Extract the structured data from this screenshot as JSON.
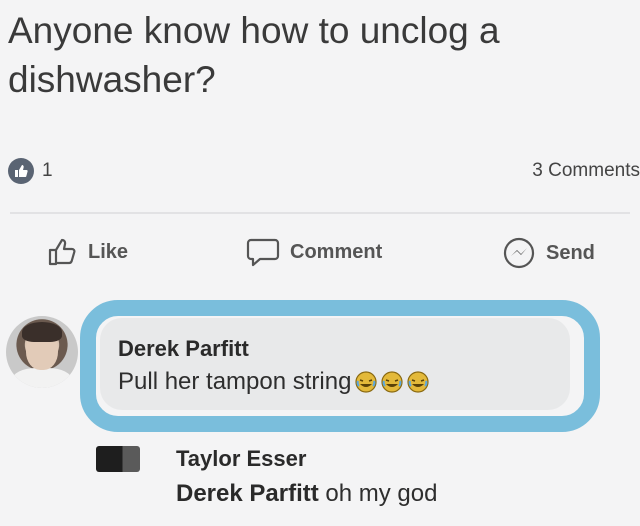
{
  "post": {
    "text": "Anyone know how to unclog a dishwasher?",
    "like_count": "1",
    "comments_count": "3 Comments"
  },
  "actions": {
    "like": "Like",
    "comment": "Comment",
    "send": "Send"
  },
  "comments": [
    {
      "author": "Derek Parfitt",
      "text": "Pull her tampon string",
      "emojis": [
        "laughing-crying-emoji",
        "laughing-crying-emoji",
        "laughing-crying-emoji"
      ],
      "highlight_color": "#6fb8d9"
    },
    {
      "author": "Taylor Esser",
      "mention": "Derek Parfitt",
      "text": " oh my god"
    }
  ],
  "colors": {
    "background": "#f4f4f5",
    "like_bubble": "#5a6473",
    "comment_bubble": "#e8e9ea"
  }
}
